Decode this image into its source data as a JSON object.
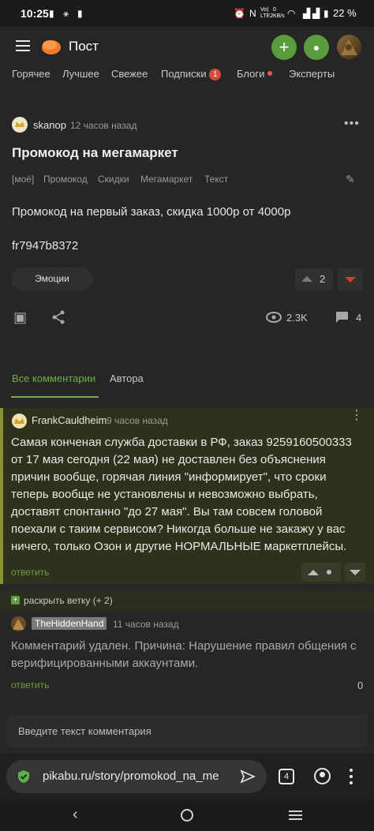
{
  "status_bar": {
    "time": "10:25",
    "battery": "22 %",
    "network": "Vo) LTE2",
    "speed": "0 KB/s",
    "signal_label": "N"
  },
  "header": {
    "title": "Пост"
  },
  "nav_tabs": [
    "Горячее",
    "Лучшее",
    "Свежее",
    "Подписки",
    "Блоги",
    "Эксперты"
  ],
  "nav_badge_count": "1",
  "post": {
    "author": "skanop",
    "time": "12 часов назад",
    "title": "Промокод на мегамаркет",
    "tags": [
      "[моё]",
      "Промокод",
      "Скидки",
      "Мегамаркет",
      "Текст"
    ],
    "body_line1": "Промокод на первый заказ, скидка 1000р от 4000р",
    "body_line2": "fr7947b8372",
    "emotions_label": "Эмоции",
    "rating": "2",
    "views": "2.3K",
    "comments_count": "4"
  },
  "comment_tabs": [
    "Все комментарии",
    "Автора"
  ],
  "comments": [
    {
      "author": "FrankCauldheim",
      "time": "9 часов назад",
      "lines": [
        "Самая конченая служба доставки в РФ, заказ 9259160500333",
        "от 17 мая сегодня (22 мая) не доставлен без объяснения",
        "причин вообще, горячая линия \"информирует\", что сроки",
        "теперь вообще не установлены и невозможно выбрать,",
        "доставят спонтанно \"до 27 мая\". Вы там совсем головой",
        "поехали с таким сервисом? Никогда больше не закажу у вас",
        "ничего, только Озон и другие НОРМАЛЬНЫЕ маркетплейсы."
      ],
      "reply": "ответить"
    },
    {
      "author": "TheHiddenHand",
      "time": "11 часов назад",
      "lines": [
        "Комментарий удален. Причина: Нарушение правил общения с",
        "верифицированными аккаунтами."
      ],
      "reply": "ответить",
      "rating": "0"
    }
  ],
  "expand_branch": "раскрыть ветку (+ 2)",
  "comment_input_placeholder": "Введите текст комментария",
  "browser": {
    "url": "pikabu.ru/story/promokod_na_me",
    "tab_count": "4"
  },
  "colors": {
    "accent_green": "#5b9c3f",
    "downvote_red": "#d43b2f",
    "highlight_bg": "#30311c"
  }
}
